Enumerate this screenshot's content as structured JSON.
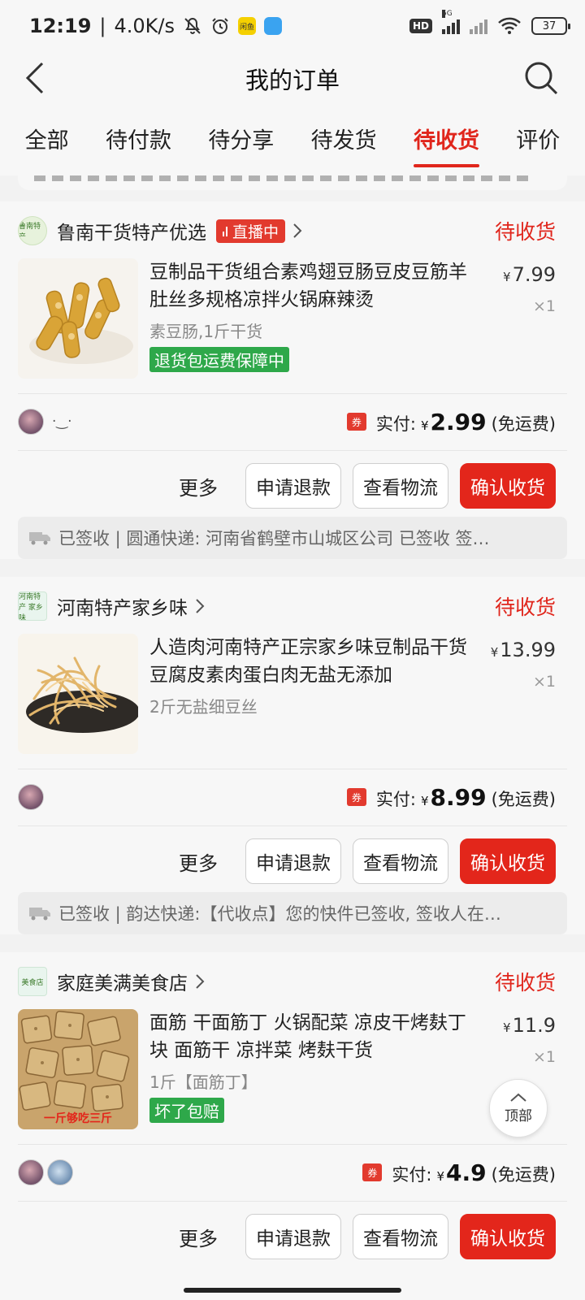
{
  "status_bar": {
    "time": "12:19",
    "speed": "4.0K/s",
    "app_badge": "闲鱼",
    "hd": "HD",
    "network": "5G",
    "battery": "37"
  },
  "header": {
    "title": "我的订单"
  },
  "tabs": [
    "全部",
    "待付款",
    "待分享",
    "待发货",
    "待收货",
    "评价"
  ],
  "active_tab": "待收货",
  "orders": [
    {
      "shop_name": "鲁南干货特产优选",
      "shop_logo_text": "鲁南特产",
      "live_label": "直播中",
      "status": "待收货",
      "product_title": "豆制品干货组合素鸡翅豆肠豆皮豆筋羊肚丝多规格凉拌火锅麻辣烫",
      "spec": "素豆肠,1斤干货",
      "tag": "退货包运费保障中",
      "currency": "¥",
      "price": "7.99",
      "qty": "×1",
      "avatar_extra": "·‿·",
      "coupon": "券",
      "paid_label": "实付:",
      "paid_amount": "2.99",
      "shipping_note": "(免运费)",
      "more": "更多",
      "btn_refund": "申请退款",
      "btn_logistics": "查看物流",
      "btn_confirm": "确认收货",
      "logistics": "已签收 | 圆通快递: 河南省鹤壁市山城区公司 已签收  签…"
    },
    {
      "shop_name": "河南特产家乡味",
      "shop_logo_text": "河南特产 家乡味",
      "status": "待收货",
      "product_title": "人造肉河南特产正宗家乡味豆制品干货豆腐皮素肉蛋白肉无盐无添加",
      "spec": "2斤无盐细豆丝",
      "currency": "¥",
      "price": "13.99",
      "qty": "×1",
      "coupon": "券",
      "paid_label": "实付:",
      "paid_amount": "8.99",
      "shipping_note": "(免运费)",
      "more": "更多",
      "btn_refund": "申请退款",
      "btn_logistics": "查看物流",
      "btn_confirm": "确认收货",
      "logistics": "已签收 | 韵达快递:【代收点】您的快件已签收, 签收人在…"
    },
    {
      "shop_name": "家庭美满美食店",
      "shop_logo_text": "美食店",
      "status": "待收货",
      "product_title": "面筋 干面筋丁 火锅配菜 凉皮干烤麸丁块 面筋干 凉拌菜 烤麸干货",
      "spec": "1斤【面筋丁】",
      "tag": "坏了包赔",
      "image_caption": "一斤够吃三斤",
      "currency": "¥",
      "price": "11.9",
      "qty": "×1",
      "coupon": "券",
      "paid_label": "实付:",
      "paid_amount": "4.9",
      "shipping_note": "(免运费)",
      "more": "更多",
      "btn_refund": "申请退款",
      "btn_logistics": "查看物流",
      "btn_confirm": "确认收货"
    }
  ],
  "top_button": "顶部",
  "colors": {
    "accent": "#e0261c",
    "confirm_button": "#e3261b",
    "green_tag": "#2ea84a",
    "page_bg": "#f2f2f2"
  },
  "icons": {
    "back": "chevron-left-icon",
    "search": "search-icon",
    "truck": "truck-icon",
    "coupon": "coupon-icon",
    "top": "arrow-up-icon"
  }
}
